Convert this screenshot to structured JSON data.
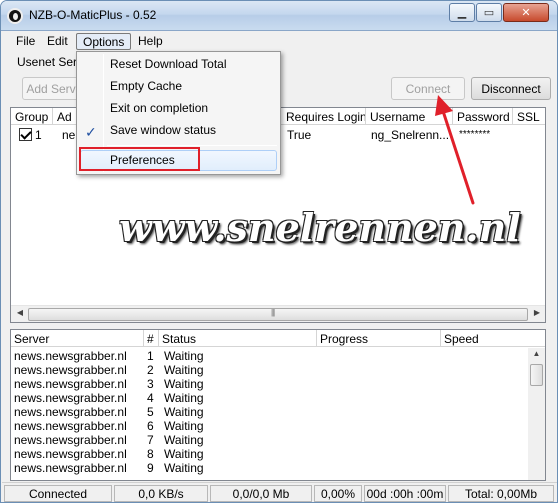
{
  "window": {
    "title": "NZB-O-MaticPlus - 0.52",
    "min_glyph": "▁",
    "max_glyph": "▭",
    "close_glyph": "✕"
  },
  "menubar": {
    "items": [
      "File",
      "Edit",
      "Options",
      "Help"
    ]
  },
  "toolbar": {
    "section_label": "Usenet Serv",
    "add_server_label": "Add Serv",
    "connect_label": "Connect",
    "disconnect_label": "Disconnect"
  },
  "servers_grid": {
    "columns": [
      "Group",
      "Ad",
      "Requires Login",
      "Username",
      "Password",
      "SSL"
    ],
    "rows": [
      {
        "group": "1",
        "address": "ne",
        "requires_login": "True",
        "username": "ng_Snelrenn...",
        "password": "********"
      }
    ]
  },
  "options_menu": {
    "items": [
      "Reset Download Total",
      "Empty Cache",
      "Exit on completion",
      "Save window status",
      "Preferences"
    ],
    "checked_item": "Save window status",
    "check_glyph": "✓"
  },
  "watermark": {
    "text": "www.snelrennen.nl"
  },
  "queue": {
    "columns": [
      "Server",
      "#",
      "Status",
      "Progress",
      "Speed"
    ],
    "rows": [
      {
        "server": "news.newsgrabber.nl",
        "num": "1",
        "status": "Waiting"
      },
      {
        "server": "news.newsgrabber.nl",
        "num": "2",
        "status": "Waiting"
      },
      {
        "server": "news.newsgrabber.nl",
        "num": "3",
        "status": "Waiting"
      },
      {
        "server": "news.newsgrabber.nl",
        "num": "4",
        "status": "Waiting"
      },
      {
        "server": "news.newsgrabber.nl",
        "num": "5",
        "status": "Waiting"
      },
      {
        "server": "news.newsgrabber.nl",
        "num": "6",
        "status": "Waiting"
      },
      {
        "server": "news.newsgrabber.nl",
        "num": "7",
        "status": "Waiting"
      },
      {
        "server": "news.newsgrabber.nl",
        "num": "8",
        "status": "Waiting"
      },
      {
        "server": "news.newsgrabber.nl",
        "num": "9",
        "status": "Waiting"
      }
    ]
  },
  "statusbar": {
    "connection": "Connected",
    "speed": "0,0 KB/s",
    "size": "0,0/0,0 Mb",
    "percent": "0,00%",
    "time": "00d :00h :00m",
    "total": "Total: 0,00Mb"
  },
  "colors": {
    "annotation_red": "#e0202a",
    "titlebar": "#c4d7ee"
  }
}
